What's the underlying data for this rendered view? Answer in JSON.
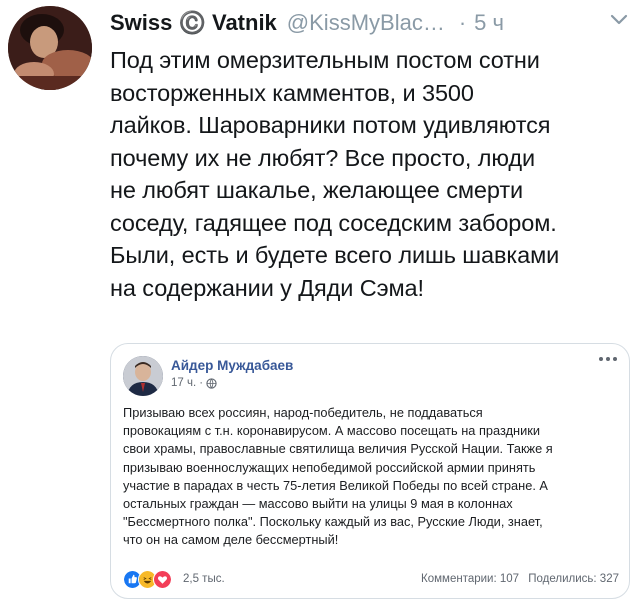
{
  "tweet": {
    "display_name": "Swiss ©️ Vatnik",
    "handle": "@KissMyBlac…",
    "separator": "·",
    "time": "5 ч",
    "text_lines": [
      "Под этим омерзительным постом сотни",
      "восторженных камментов, и 3500",
      "лайков. Шароварники потом удивляются",
      "почему их не любят? Все просто, люди",
      "не любят шакалье, желающее смерти",
      "соседу, гадящее под соседским забором.",
      "Были, есть и будете всего лишь шавками",
      "на содержании у Дяди Сэма!"
    ]
  },
  "embedded_post": {
    "author": "Айдер Муждабаев",
    "time": "17 ч.",
    "meta_separator": "·",
    "text_lines": [
      "Призываю всех россиян, народ-победитель, не поддаваться",
      "провокациям с т.н. коронавирусом. А массово посещать на праздники",
      "свои храмы, православные святилища величия Русской Нации. Также я",
      "призываю военнослужащих непобедимой российской армии принять",
      "участие в парадах в честь 75-летия Великой Победы по всей стране. А",
      "остальных граждан — массово выйти на улицы 9 мая в колоннах",
      "\"Бессмертного полка\". Поскольку каждый из вас, Русские Люди, знает,",
      "что он на самом деле бессмертный!"
    ],
    "reactions_count": "2,5 тыс.",
    "comments": "Комментарии: 107",
    "shares": "Поделились: 327"
  },
  "icons": {
    "tweet_menu": "chevron-down-icon",
    "post_menu": "more-dots-icon",
    "privacy": "globe-icon",
    "reactions": [
      "like-icon",
      "haha-icon",
      "love-icon"
    ]
  },
  "colors": {
    "text": "#14171a",
    "secondary": "#8a9aa6",
    "fb_name": "#385898",
    "like": "#1877f2",
    "haha": "#f7b928",
    "love": "#f33e58",
    "card_border": "#d6dde3"
  }
}
